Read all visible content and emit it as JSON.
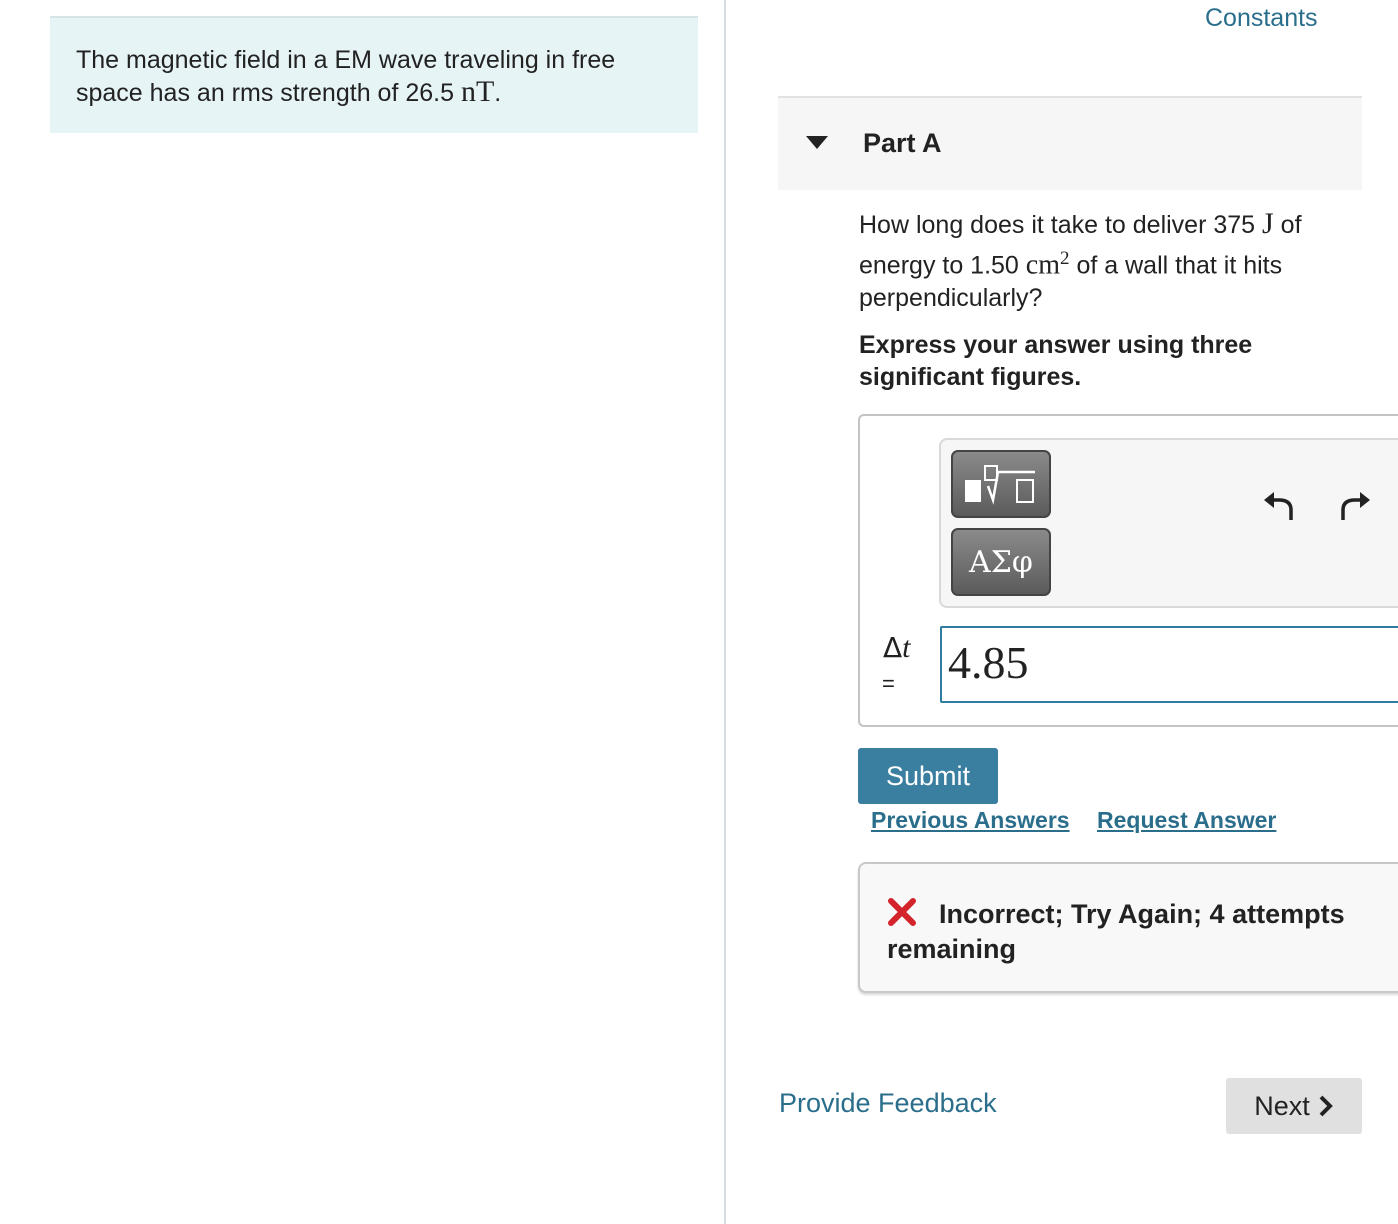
{
  "problem": {
    "text": "The magnetic field in a EM wave traveling in free space has an rms strength of 26.5",
    "unit": "nT",
    "end": "."
  },
  "header": {
    "constants_label": "Constants"
  },
  "part": {
    "title": "Part A",
    "question": {
      "before_energy": "How long does it take to deliver 375",
      "energy_unit": "J",
      "after_energy": "of energy to 1.50",
      "area_unit": "cm",
      "area_exponent": "2",
      "after_area": "of a wall that it hits perpendicularly?"
    },
    "instruction": "Express your answer using three significant figures."
  },
  "answer": {
    "variable_symbol": "Δ",
    "variable_name": "t",
    "equals": "=",
    "value": "4.85",
    "symbols_button_label": "ΑΣφ"
  },
  "actions": {
    "submit_label": "Submit",
    "previous_answers_label": "Previous Answers",
    "request_answer_label": "Request Answer"
  },
  "feedback": {
    "message": "Incorrect; Try Again; 4 attempts remaining"
  },
  "footer": {
    "provide_feedback_label": "Provide Feedback",
    "next_label": "Next"
  },
  "colors": {
    "accent": "#3a7f9f",
    "link": "#2a6e8c",
    "problem_bg": "#e7f4f6",
    "error": "#d4242b"
  }
}
